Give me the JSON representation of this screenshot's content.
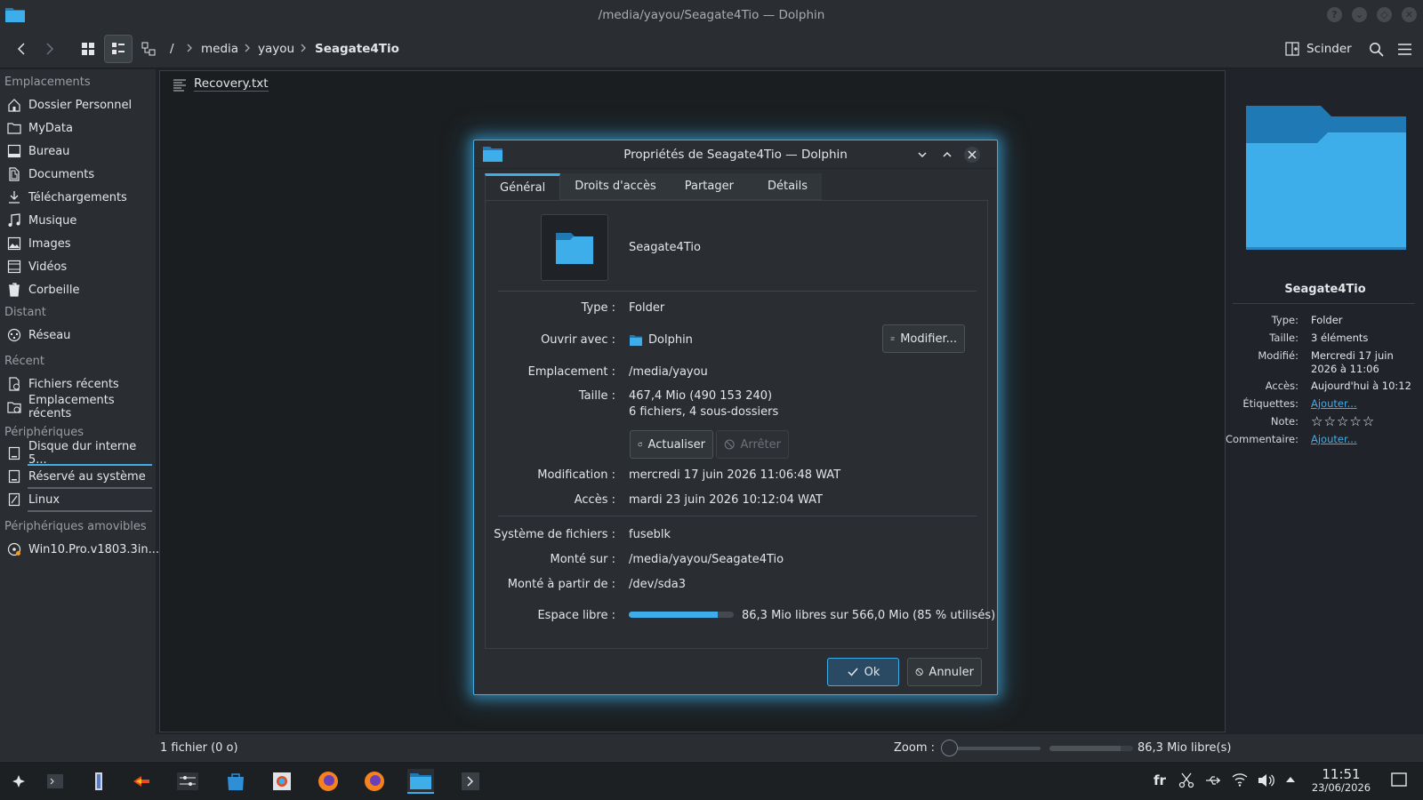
{
  "window": {
    "title": "/media/yayou/Seagate4Tio — Dolphin"
  },
  "toolbar": {
    "breadcrumbs": [
      "/",
      "media",
      "yayou",
      "Seagate4Tio"
    ],
    "split_label": "Scinder"
  },
  "sidebar": {
    "sections": [
      {
        "title": "Emplacements",
        "items": [
          {
            "label": "Dossier Personnel",
            "icon": "home-icon"
          },
          {
            "label": "MyData",
            "icon": "folder-icon"
          },
          {
            "label": "Bureau",
            "icon": "desktop-icon"
          },
          {
            "label": "Documents",
            "icon": "documents-icon"
          },
          {
            "label": "Téléchargements",
            "icon": "download-icon"
          },
          {
            "label": "Musique",
            "icon": "music-icon"
          },
          {
            "label": "Images",
            "icon": "image-icon"
          },
          {
            "label": "Vidéos",
            "icon": "video-icon"
          },
          {
            "label": "Corbeille",
            "icon": "trash-icon"
          }
        ]
      },
      {
        "title": "Distant",
        "items": [
          {
            "label": "Réseau",
            "icon": "network-icon"
          }
        ]
      },
      {
        "title": "Récent",
        "items": [
          {
            "label": "Fichiers récents",
            "icon": "recent-files-icon"
          },
          {
            "label": "Emplacements récents",
            "icon": "recent-locations-icon"
          }
        ]
      },
      {
        "title": "Périphériques",
        "items": [
          {
            "label": "Disque dur interne 5...",
            "icon": "drive-icon",
            "usage": 0.6
          },
          {
            "label": "Réservé au système",
            "icon": "drive-icon",
            "usage": 0.4
          },
          {
            "label": "Linux",
            "icon": "drive-icon",
            "usage": 0.8
          }
        ]
      },
      {
        "title": "Périphériques amovibles",
        "items": [
          {
            "label": "Win10.Pro.v1803.3in...",
            "icon": "disc-icon"
          }
        ]
      }
    ]
  },
  "files": [
    {
      "name": "Recovery.txt",
      "icon": "text-file-icon"
    }
  ],
  "info_panel": {
    "name": "Seagate4Tio",
    "rows": [
      {
        "key": "Type:",
        "value": "Folder"
      },
      {
        "key": "Taille:",
        "value": "3 éléments"
      },
      {
        "key": "Modifié:",
        "value": "Mercredi 17 juin 2026 à 11:06"
      },
      {
        "key": "Accès:",
        "value": "Aujourd'hui à 10:12"
      },
      {
        "key": "Étiquettes:",
        "value": "Ajouter..."
      },
      {
        "key": "Note:",
        "value": ""
      },
      {
        "key": "Commentaire:",
        "value": "Ajouter..."
      }
    ],
    "rating_stars": 0
  },
  "statusbar": {
    "left": "1 fichier (0 o)",
    "zoom_label": "Zoom :",
    "zoom_level": 0,
    "free_fraction": 0.85,
    "free_text": "86,3 Mio libre(s)"
  },
  "dialog": {
    "title": "Propriétés de Seagate4Tio — Dolphin",
    "tabs": [
      "Général",
      "Droits d'accès",
      "Partager",
      "Détails"
    ],
    "folder_name": "Seagate4Tio",
    "type_label": "Type :",
    "type_value": "Folder",
    "open_with_label": "Ouvrir avec :",
    "open_with_value": "Dolphin",
    "modify_button": "Modifier...",
    "location_label": "Emplacement :",
    "location_value": "/media/yayou",
    "size_label": "Taille :",
    "size_value": "467,4 Mio (490 153 240)",
    "size_detail": "6 fichiers, 4 sous-dossiers",
    "refresh_button": "Actualiser",
    "stop_button": "Arrêter",
    "modified_label": "Modification :",
    "modified_value": "mercredi 17 juin 2026 11:06:48 WAT",
    "accessed_label": "Accès :",
    "accessed_value": "mardi 23 juin 2026 10:12:04 WAT",
    "fs_label": "Système de fichiers :",
    "fs_value": "fuseblk",
    "mounted_on_label": "Monté sur :",
    "mounted_on_value": "/media/yayou/Seagate4Tio",
    "mounted_from_label": "Monté à partir de :",
    "mounted_from_value": "/dev/sda3",
    "free_label": "Espace libre :",
    "free_value": "86,3 Mio libres sur 566,0 Mio (85 % utilisés)",
    "used_fraction": 0.85,
    "ok_button": "Ok",
    "cancel_button": "Annuler"
  },
  "taskbar": {
    "keyboard_layout": "fr",
    "time": "11:51",
    "date": "23/06/2026"
  },
  "colors": {
    "accent": "#3daee9",
    "background": "#20232a",
    "panel": "#2a2e32"
  }
}
